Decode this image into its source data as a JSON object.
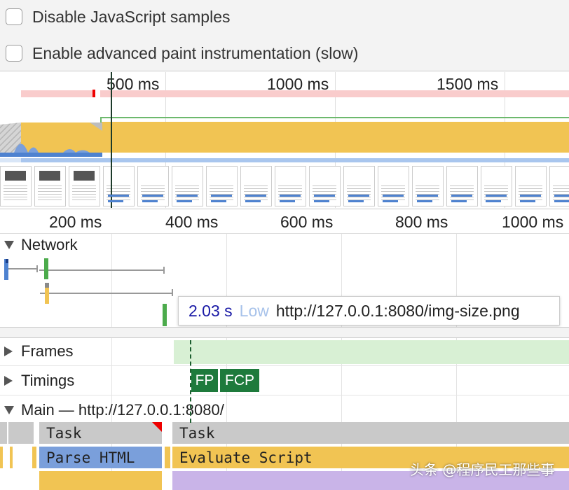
{
  "settings": {
    "disable_js_samples": "Disable JavaScript samples",
    "advanced_paint": "Enable advanced paint instrumentation (slow)"
  },
  "overview": {
    "ticks": [
      "500 ms",
      "1000 ms",
      "1500 ms"
    ]
  },
  "ruler": {
    "ticks": [
      "200 ms",
      "400 ms",
      "600 ms",
      "800 ms",
      "1000 ms"
    ]
  },
  "tracks": {
    "network": "Network",
    "frames": "Frames",
    "timings": "Timings",
    "main": "Main — http://127.0.0.1:8080/"
  },
  "tooltip": {
    "time": "2.03 s",
    "priority": "Low",
    "url": "http://127.0.0.1:8080/img-size.png"
  },
  "markers": {
    "fp": "FP",
    "fcp": "FCP"
  },
  "flame": {
    "task1": "Task",
    "task2": "Task",
    "parse_html": "Parse HTML",
    "evaluate_script": "Evaluate Script"
  },
  "colors": {
    "scripting": "#f1c453",
    "loading": "#7a9fdb",
    "task": "#c9c9c9",
    "marker": "#1e7a3c"
  },
  "watermark": "头条 @程序民工那些事"
}
